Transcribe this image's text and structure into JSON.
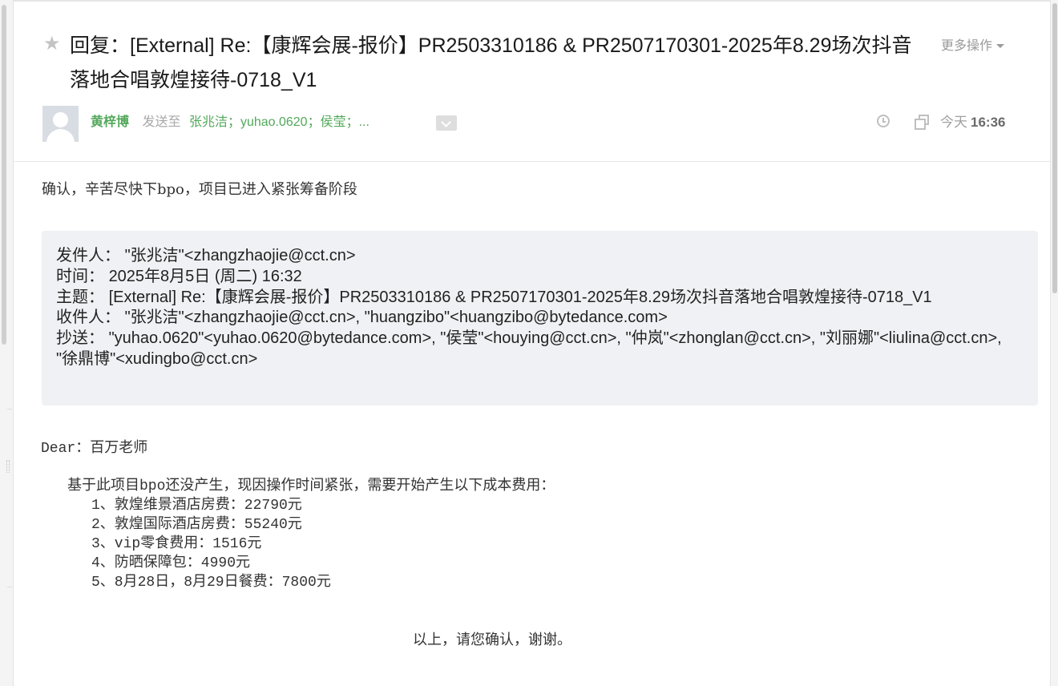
{
  "email": {
    "subject": "回复：[External] Re:【康辉会展-报价】PR2503310186 & PR2507170301-2025年8.29场次抖音落地合唱敦煌接待-0718_V1",
    "more_actions": "更多操作",
    "sender": "黄梓博",
    "sent_to_label": "发送至",
    "recipients_summary": "张兆洁；yuhao.0620；侯莹；...",
    "date_label": "今天",
    "time": "16:36"
  },
  "reply": {
    "text": "确认，辛苦尽快下bpo，项目已进入紧张筹备阶段"
  },
  "quote": {
    "from_label": "发件人：",
    "from": "\"张兆洁\"<zhangzhaojie@cct.cn>",
    "time_label": "时间：",
    "time": "2025年8月5日 (周二) 16:32",
    "subject_label": "主题：",
    "subject": "[External] Re:【康辉会展-报价】PR2503310186 & PR2507170301-2025年8.29场次抖音落地合唱敦煌接待-0718_V1",
    "to_label": "收件人：",
    "to": "\"张兆洁\"<zhangzhaojie@cct.cn>, \"huangzibo\"<huangzibo@bytedance.com>",
    "cc_label": "抄送：",
    "cc": "\"yuhao.0620\"<yuhao.0620@bytedance.com>, \"侯莹\"<houying@cct.cn>, \"仲岚\"<zhonglan@cct.cn>, \"刘丽娜\"<liulina@cct.cn>, \"徐鼎博\"<xudingbo@cct.cn>"
  },
  "body": {
    "greeting": "Dear：百万老师",
    "intro": "基于此项目bpo还没产生，现因操作时间紧张，需要开始产生以下成本费用：",
    "items": [
      "1、敦煌维景酒店房费：22790元",
      "2、敦煌国际酒店房费：55240元",
      "3、vip零食费用：1516元",
      "4、防晒保障包：4990元",
      "5、8月28日，8月29日餐费：7800元"
    ],
    "closing": "以上，请您确认，谢谢。"
  }
}
